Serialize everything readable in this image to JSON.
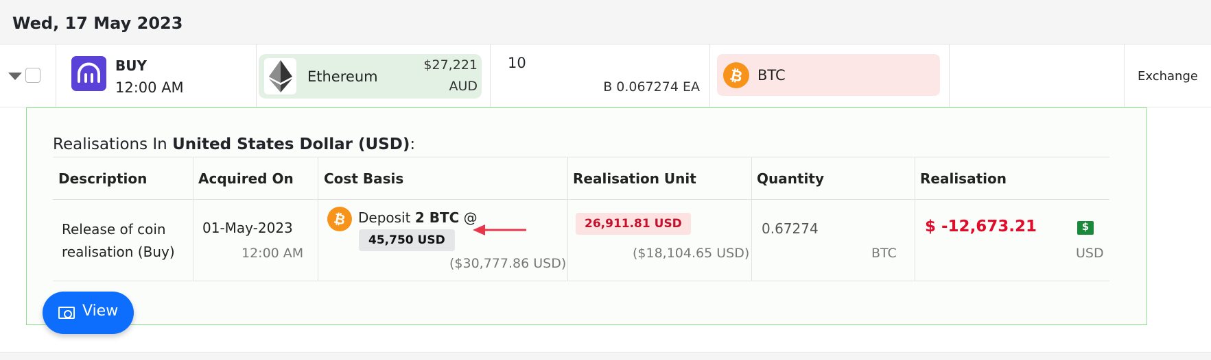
{
  "date_header": "Wed, 17 May 2023",
  "transaction": {
    "type": "BUY",
    "time": "12:00 AM",
    "coin": {
      "name": "Ethereum",
      "price": "$27,221",
      "currency": "AUD"
    },
    "quantity": "10",
    "quantity_sub": "B 0.067274 EA",
    "counter_coin": "BTC",
    "source": "Exchange"
  },
  "realisations": {
    "title_prefix": "Realisations In ",
    "title_currency": "United States Dollar (USD)",
    "title_suffix": ":",
    "columns": [
      "Description",
      "Acquired On",
      "Cost Basis",
      "Realisation Unit",
      "Quantity",
      "Realisation"
    ],
    "row": {
      "description_line1": "Release of coin",
      "description_line2": "realisation (Buy)",
      "acquired_date": "01-May-2023",
      "acquired_time": "12:00 AM",
      "cost_basis_prefix": "Deposit ",
      "cost_basis_amount": "2 BTC",
      "cost_basis_at": " @",
      "cost_basis_price": "45,750 USD",
      "cost_basis_total": "($30,777.86 USD)",
      "unit_value": "26,911.81 USD",
      "unit_total": "($18,104.65 USD)",
      "quantity": "0.67274",
      "quantity_unit": "BTC",
      "realisation": "$ -12,673.21",
      "realisation_unit": "USD"
    }
  },
  "view_button": "View",
  "colors": {
    "accent": "#0d6efd",
    "loss": "#e00c2a",
    "btc": "#f7931a",
    "exchange_logo": "#5a41d8"
  }
}
